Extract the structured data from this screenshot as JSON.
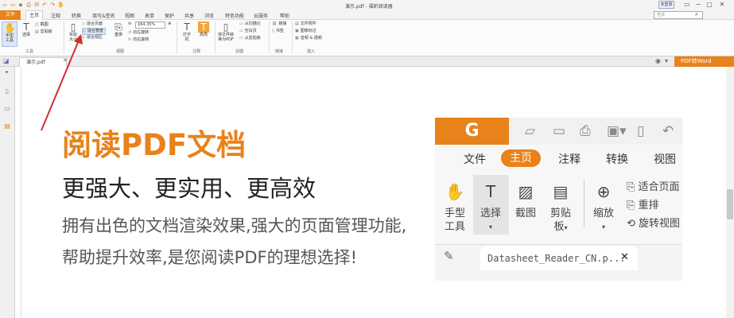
{
  "window": {
    "title": "演示.pdf - 福昕阅读器",
    "login": "未登录",
    "search_placeholder": "查找"
  },
  "menu": [
    "文件",
    "主页",
    "注释",
    "转换",
    "填写&签名",
    "视图",
    "表单",
    "保护",
    "共享",
    "浏览",
    "特色功能",
    "云服务",
    "帮助"
  ],
  "ribbon": {
    "hand": "手型工具",
    "select": "选择",
    "snapshot": "截图",
    "clipboard": "剪贴板",
    "group_tools": "工具",
    "actual": "实际大小",
    "fit_page": "适合页面",
    "fit_width": "适合宽度",
    "fit_visible": "适合视区",
    "zoom_value": "164.35%",
    "rotate_left": "向左旋转",
    "rotate_right": "向右旋转",
    "reflow": "重排",
    "group_view": "视图",
    "typewriter": "打字机",
    "highlight": "高亮",
    "group_comment": "注释",
    "to_pdf": "将文件转换为PDF",
    "from_scanner": "从扫描仪",
    "blank": "空白页",
    "from_clipboard": "从剪贴板",
    "group_create": "创建",
    "link": "链接",
    "bookmark": "书签",
    "group_link": "链接",
    "attach": "文件附件",
    "image_annot": "图像标注",
    "audio_video": "音频 & 视频",
    "group_insert": "插入"
  },
  "tab": {
    "name": "演示.pdf"
  },
  "pdf2word": "PDF转Word",
  "content": {
    "headline": "阅读PDF文档",
    "subheadline": "更强大、更实用、更高效",
    "body1": "拥有出色的文档渲染效果,强大的页面管理功能,",
    "body2": "帮助提升效率,是您阅读PDF的理想选择!"
  },
  "panel": {
    "tabs": [
      "文件",
      "主页",
      "注释",
      "转换",
      "视图"
    ],
    "hand": "手型",
    "hand2": "工具",
    "select": "选择",
    "snapshot": "截图",
    "clip": "剪贴",
    "clip2": "板",
    "zoom": "缩放",
    "fit_page": "适合页面",
    "reflow": "重排",
    "rotate": "旋转视图",
    "doc_tab": "Datasheet_Reader_CN.p..."
  },
  "colors": {
    "accent": "#e8821a"
  }
}
